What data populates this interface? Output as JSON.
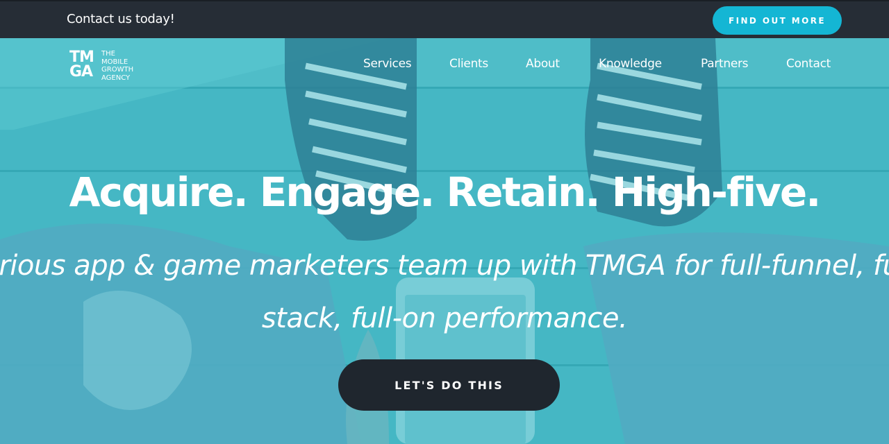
{
  "topbar": {
    "contact_text": "Contact us today!",
    "cta_label": "FIND OUT MORE"
  },
  "logo": {
    "mark_line1": "TM",
    "mark_line2": "GA",
    "tagline_line1": "THE",
    "tagline_line2": "MOBILE",
    "tagline_line3": "GROWTH",
    "tagline_line4": "AGENCY"
  },
  "nav": {
    "items": [
      {
        "label": "Services"
      },
      {
        "label": "Clients"
      },
      {
        "label": "About"
      },
      {
        "label": "Knowledge"
      },
      {
        "label": "Partners"
      },
      {
        "label": "Contact"
      }
    ]
  },
  "hero": {
    "headline": "Acquire. Engage. Retain. High-five.",
    "subline_1": "Serious app & game marketers team up with TMGA for full-funnel, full-",
    "subline_2": "stack, full-on performance.",
    "cta_label": "LET'S DO THIS"
  },
  "colors": {
    "topbar_bg": "#262d36",
    "accent": "#14b6d4",
    "hero_tint": "#3cb1bf",
    "cta_dark": "#1f262e"
  }
}
